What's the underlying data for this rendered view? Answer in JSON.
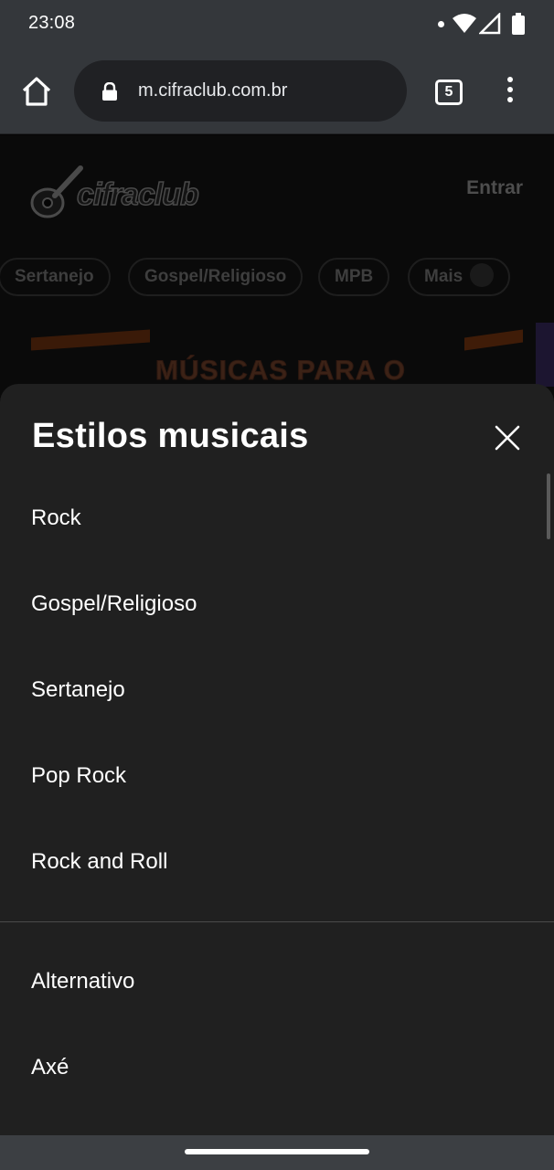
{
  "status_bar": {
    "time": "23:08",
    "icons": [
      "notification-dot-icon",
      "wifi-icon",
      "signal-icon",
      "battery-icon"
    ]
  },
  "browser": {
    "url": "m.cifraclub.com.br",
    "tab_count": "5",
    "icons": [
      "home-icon",
      "lock-icon",
      "tabs-icon",
      "more-vert-icon"
    ]
  },
  "page": {
    "logo_text": "cifraclub",
    "login_label": "Entrar",
    "chips": [
      "Sertanejo",
      "Gospel/Religioso",
      "MPB",
      "Mais"
    ],
    "banner_text": "MÚSICAS PARA O"
  },
  "sheet": {
    "title": "Estilos musicais",
    "top_items": [
      "Rock",
      "Gospel/Religioso",
      "Sertanejo",
      "Pop Rock",
      "Rock and Roll"
    ],
    "other_items": [
      "Alternativo",
      "Axé"
    ]
  },
  "colors": {
    "sheet_bg": "#202020",
    "chrome_bg": "#34373b",
    "omnibox_bg": "#202124",
    "page_bg": "#0a0a0a",
    "banner_orange": "#3a1a08"
  }
}
